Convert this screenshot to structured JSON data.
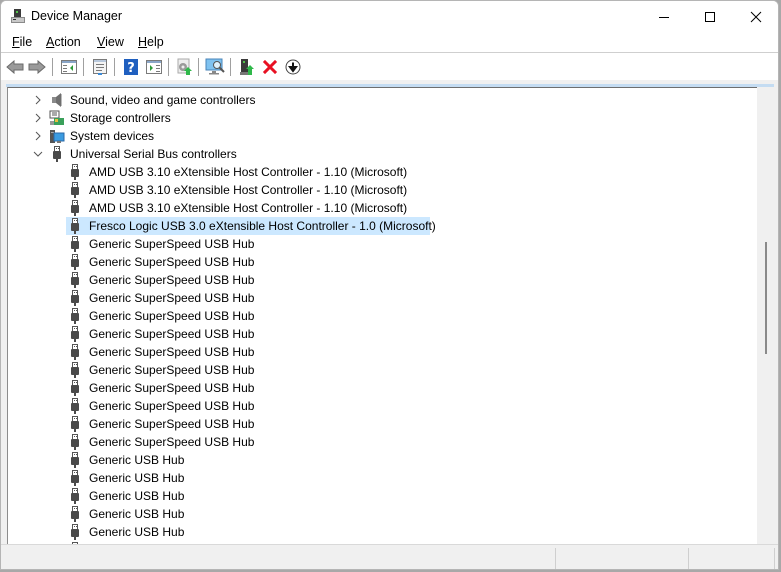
{
  "window": {
    "title": "Device Manager",
    "controls": [
      "minimize",
      "maximize",
      "close"
    ]
  },
  "menu": {
    "items": [
      {
        "label": "File",
        "accel": "F",
        "rest": "ile"
      },
      {
        "label": "Action",
        "accel": "A",
        "rest": "ction"
      },
      {
        "label": "View",
        "accel": "V",
        "rest": "iew"
      },
      {
        "label": "Help",
        "accel": "H",
        "rest": "elp"
      }
    ]
  },
  "toolbar": {
    "buttons": [
      {
        "name": "back",
        "icon": "arrow-left-icon",
        "enabled": false
      },
      {
        "name": "forward",
        "icon": "arrow-right-icon",
        "enabled": false
      },
      {
        "name": "show-hide-console-tree",
        "icon": "console-tree-icon",
        "enabled": true
      },
      {
        "name": "properties",
        "icon": "properties-icon",
        "enabled": true
      },
      {
        "name": "help",
        "icon": "help-icon",
        "enabled": true
      },
      {
        "name": "show-action-pane",
        "icon": "action-pane-icon",
        "enabled": true
      },
      {
        "name": "update-driver",
        "icon": "update-driver-icon",
        "enabled": true
      },
      {
        "name": "scan-hardware-changes",
        "icon": "scan-hardware-icon",
        "enabled": true
      },
      {
        "name": "enable-device",
        "icon": "enable-device-icon",
        "enabled": true
      },
      {
        "name": "uninstall-device",
        "icon": "uninstall-icon",
        "enabled": true
      },
      {
        "name": "disable-device",
        "icon": "disable-device-icon",
        "enabled": true
      }
    ]
  },
  "tree": {
    "categories": [
      {
        "label": "Sound, video and game controllers",
        "expanded": false,
        "icon": "speaker-icon"
      },
      {
        "label": "Storage controllers",
        "expanded": false,
        "icon": "storage-controller-icon"
      },
      {
        "label": "System devices",
        "expanded": false,
        "icon": "system-devices-icon"
      },
      {
        "label": "Universal Serial Bus controllers",
        "expanded": true,
        "icon": "usb-icon"
      }
    ],
    "usb_devices": [
      {
        "label": "AMD USB 3.10 eXtensible Host Controller - 1.10 (Microsoft)",
        "selected": false
      },
      {
        "label": "AMD USB 3.10 eXtensible Host Controller - 1.10 (Microsoft)",
        "selected": false
      },
      {
        "label": "AMD USB 3.10 eXtensible Host Controller - 1.10 (Microsoft)",
        "selected": false
      },
      {
        "label": "Fresco Logic USB 3.0 eXtensible Host Controller - 1.0 (Microsoft)",
        "selected": true
      },
      {
        "label": "Generic SuperSpeed USB Hub",
        "selected": false
      },
      {
        "label": "Generic SuperSpeed USB Hub",
        "selected": false
      },
      {
        "label": "Generic SuperSpeed USB Hub",
        "selected": false
      },
      {
        "label": "Generic SuperSpeed USB Hub",
        "selected": false
      },
      {
        "label": "Generic SuperSpeed USB Hub",
        "selected": false
      },
      {
        "label": "Generic SuperSpeed USB Hub",
        "selected": false
      },
      {
        "label": "Generic SuperSpeed USB Hub",
        "selected": false
      },
      {
        "label": "Generic SuperSpeed USB Hub",
        "selected": false
      },
      {
        "label": "Generic SuperSpeed USB Hub",
        "selected": false
      },
      {
        "label": "Generic SuperSpeed USB Hub",
        "selected": false
      },
      {
        "label": "Generic SuperSpeed USB Hub",
        "selected": false
      },
      {
        "label": "Generic SuperSpeed USB Hub",
        "selected": false
      },
      {
        "label": "Generic USB Hub",
        "selected": false
      },
      {
        "label": "Generic USB Hub",
        "selected": false
      },
      {
        "label": "Generic USB Hub",
        "selected": false
      },
      {
        "label": "Generic USB Hub",
        "selected": false
      },
      {
        "label": "Generic USB Hub",
        "selected": false
      },
      {
        "label": "",
        "selected": false
      }
    ]
  },
  "colors": {
    "selection": "#cce8ff",
    "uninstall_red": "#e81123",
    "help_blue": "#1f5fbf"
  },
  "statusbar": {
    "panes": [
      "",
      "",
      ""
    ]
  }
}
